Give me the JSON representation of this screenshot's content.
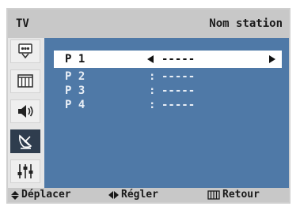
{
  "header": {
    "tv_label": "TV",
    "title": "Nom station"
  },
  "sidebar": {
    "items": [
      {
        "icon": "input-icon",
        "active": false
      },
      {
        "icon": "picture-icon",
        "active": false
      },
      {
        "icon": "sound-icon",
        "active": false
      },
      {
        "icon": "channel-icon",
        "active": true
      },
      {
        "icon": "setup-icon",
        "active": false
      }
    ]
  },
  "channels": [
    {
      "label": "P 1",
      "separator": "",
      "value": "-----",
      "selected": true
    },
    {
      "label": "P 2",
      "separator": ":",
      "value": "-----",
      "selected": false
    },
    {
      "label": "P 3",
      "separator": ":",
      "value": "-----",
      "selected": false
    },
    {
      "label": "P 4",
      "separator": ":",
      "value": "-----",
      "selected": false
    }
  ],
  "footer": {
    "move_label": "Déplacer",
    "adjust_label": "Régler",
    "return_label": "Retour"
  },
  "colors": {
    "menu_background": "#4f79a7",
    "header_background": "#c8c8c8",
    "selection": "#ffffff",
    "active_tab": "#2f3d4e"
  }
}
